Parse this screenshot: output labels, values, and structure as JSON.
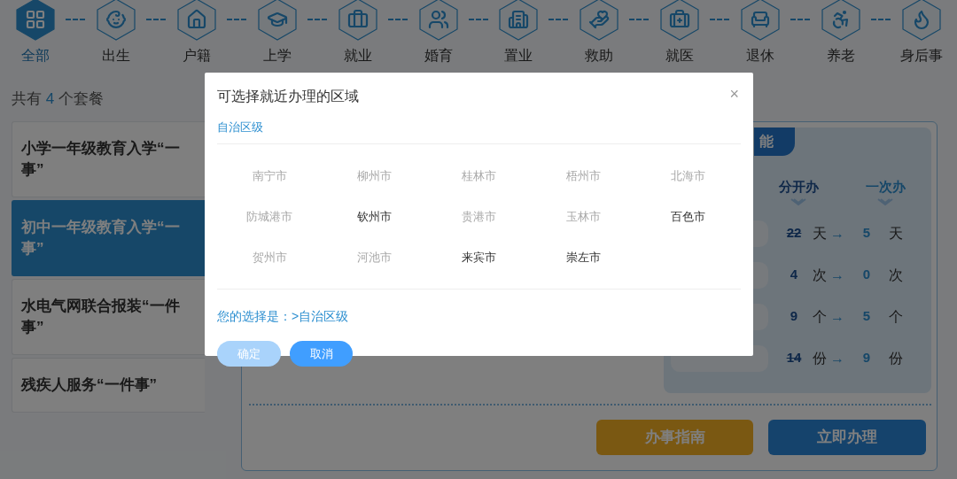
{
  "categories": [
    {
      "label": "全部",
      "selected": true
    },
    {
      "label": "出生",
      "selected": false
    },
    {
      "label": "户籍",
      "selected": false
    },
    {
      "label": "上学",
      "selected": false
    },
    {
      "label": "就业",
      "selected": false
    },
    {
      "label": "婚育",
      "selected": false
    },
    {
      "label": "置业",
      "selected": false
    },
    {
      "label": "救助",
      "selected": false
    },
    {
      "label": "就医",
      "selected": false
    },
    {
      "label": "退休",
      "selected": false
    },
    {
      "label": "养老",
      "selected": false
    },
    {
      "label": "身后事",
      "selected": false
    }
  ],
  "package_count": {
    "prefix": "共有",
    "count": "4",
    "suffix": "个套餐"
  },
  "packages": [
    {
      "lines": [
        "小学一年级教育入学“一",
        "事”"
      ],
      "selected": false
    },
    {
      "lines": [
        "初中一年级教育入学“一",
        "事”"
      ],
      "selected": true
    },
    {
      "lines": [
        "水电气网联合报装“一件",
        "事”"
      ],
      "selected": false
    },
    {
      "lines": [
        "残疾人服务“一件事”"
      ],
      "selected": false
    }
  ],
  "detail": {
    "tab": "能",
    "headers": [
      "分开办",
      "一次办"
    ],
    "rows": [
      {
        "before": "22",
        "struck": true,
        "unit": "天",
        "after": "5",
        "unit_after": "天"
      },
      {
        "before": "4",
        "struck": false,
        "unit": "次",
        "after": "0",
        "unit_after": "次"
      },
      {
        "before": "9",
        "struck": false,
        "unit": "个",
        "after": "5",
        "unit_after": "个"
      },
      {
        "before": "14",
        "struck": true,
        "unit": "份",
        "after": "9",
        "unit_after": "份"
      }
    ],
    "arrow": "→",
    "buttons": [
      "办事指南",
      "立即办理"
    ]
  },
  "dialog": {
    "title": "可选择就近办理的区域",
    "close": "×",
    "level_tab": "自治区级",
    "cities": [
      {
        "name": "南宁市",
        "disabled": true
      },
      {
        "name": "柳州市",
        "disabled": true
      },
      {
        "name": "桂林市",
        "disabled": true
      },
      {
        "name": "梧州市",
        "disabled": true
      },
      {
        "name": "北海市",
        "disabled": true
      },
      {
        "name": "防城港市",
        "disabled": true
      },
      {
        "name": "钦州市",
        "disabled": false
      },
      {
        "name": "贵港市",
        "disabled": true
      },
      {
        "name": "玉林市",
        "disabled": true
      },
      {
        "name": "百色市",
        "disabled": false
      },
      {
        "name": "贺州市",
        "disabled": true
      },
      {
        "name": "河池市",
        "disabled": true
      },
      {
        "name": "来宾市",
        "disabled": false
      },
      {
        "name": "崇左市",
        "disabled": false
      }
    ],
    "selection": "您的选择是：>自治区级",
    "confirm": {
      "label": "确定",
      "disabled": true
    },
    "cancel": {
      "label": "取消"
    }
  }
}
